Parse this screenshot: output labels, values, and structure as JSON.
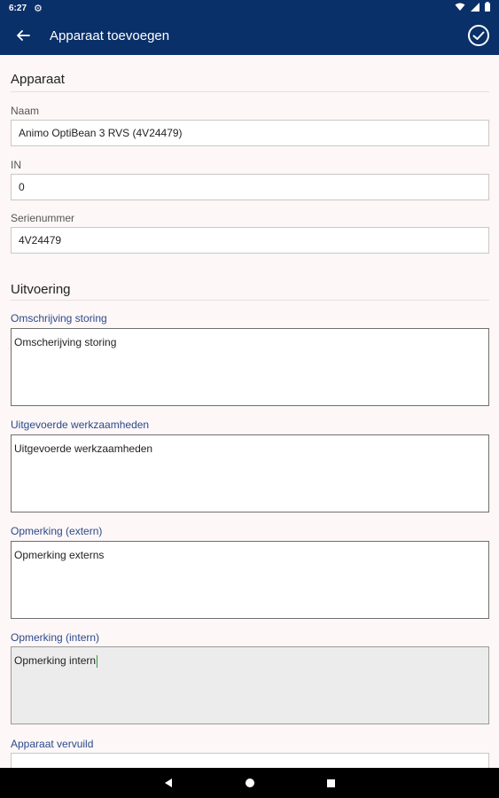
{
  "status_bar": {
    "time": "6:27",
    "settings_icon": "gear-icon",
    "wifi_icon": "wifi-icon",
    "signal_icon": "signal-icon",
    "battery_icon": "battery-icon"
  },
  "toolbar": {
    "title": "Apparaat toevoegen",
    "back_icon": "arrow-left-icon",
    "confirm_icon": "check-circle-icon"
  },
  "sections": {
    "apparaat": {
      "title": "Apparaat",
      "fields": {
        "naam": {
          "label": "Naam",
          "value": "Animo OptiBean 3 RVS (4V24479)"
        },
        "in": {
          "label": "IN",
          "value": "0"
        },
        "serienummer": {
          "label": "Serienummer",
          "value": "4V24479"
        }
      }
    },
    "uitvoering": {
      "title": "Uitvoering",
      "fields": {
        "omschrijving_storing": {
          "label": "Omschrijving storing",
          "value": "Omscherijving storing"
        },
        "uitgevoerde_werkzaamheden": {
          "label": "Uitgevoerde werkzaamheden",
          "value": "Uitgevoerde werkzaamheden"
        },
        "opmerking_extern": {
          "label": "Opmerking (extern)",
          "value": "Opmerking externs"
        },
        "opmerking_intern": {
          "label": "Opmerking (intern)",
          "value": "Opmerking intern"
        },
        "apparaat_vervuild": {
          "label": "Apparaat vervuild"
        }
      }
    }
  },
  "nav_bar": {
    "back_icon": "nav-back-triangle-icon",
    "home_icon": "nav-home-circle-icon",
    "recents_icon": "nav-recents-square-icon"
  },
  "colors": {
    "primary": "#0a3069",
    "label_blue": "#2b4a8b",
    "background": "#fdf7f7",
    "caret": "#2a9d3a"
  }
}
